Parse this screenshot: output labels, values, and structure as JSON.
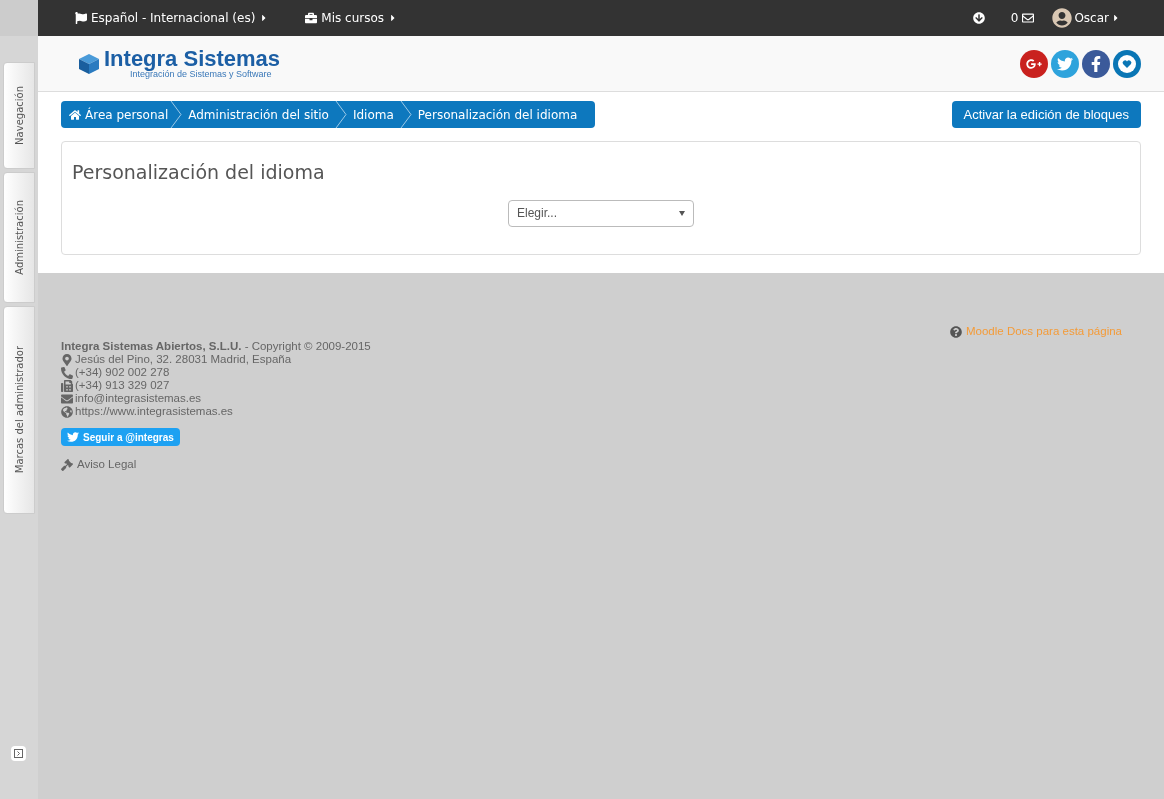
{
  "dock": {
    "tabs": [
      {
        "label": "Navegación"
      },
      {
        "label": "Administración"
      },
      {
        "label": "Marcas del administrador"
      }
    ]
  },
  "topbar": {
    "language": "Español - Internacional (es)",
    "courses": "Mis cursos",
    "messages": "0",
    "user": "Oscar"
  },
  "header": {
    "logo_title": "Integra Sistemas",
    "logo_subtitle": "Integración de Sistemas y Software",
    "social": [
      {
        "kind": "google-plus"
      },
      {
        "kind": "twitter"
      },
      {
        "kind": "facebook"
      },
      {
        "kind": "other"
      }
    ]
  },
  "breadcrumb": [
    {
      "label": "Área personal",
      "kind": "home"
    },
    {
      "label": "Administración del sitio",
      "kind": "link"
    },
    {
      "label": "Idioma",
      "kind": "link"
    },
    {
      "label": "Personalización del idioma",
      "kind": "link"
    }
  ],
  "edit_button": "Activar la edición de bloques",
  "main": {
    "heading": "Personalización del idioma",
    "select": {
      "value": "Elegir..."
    }
  },
  "footer": {
    "docs_link": "Moodle Docs para esta página",
    "lines": [
      {
        "kind": "company",
        "text": "**Integra Sistemas Abiertos, S.L.U.** - Copyright © 2009-2015"
      },
      {
        "kind": "address",
        "text": "Jesús del Pino, 32. 28031 Madrid, España"
      },
      {
        "kind": "phone",
        "text": "(+34) 902 002 278"
      },
      {
        "kind": "fax",
        "text": "(+34) 913 329 027"
      },
      {
        "kind": "email",
        "text": "info@integrasistemas.es"
      },
      {
        "kind": "web",
        "text": "https://www.integrasistemas.es"
      }
    ],
    "follow_button": "Seguir a @integras",
    "legal": "Aviso Legal"
  }
}
